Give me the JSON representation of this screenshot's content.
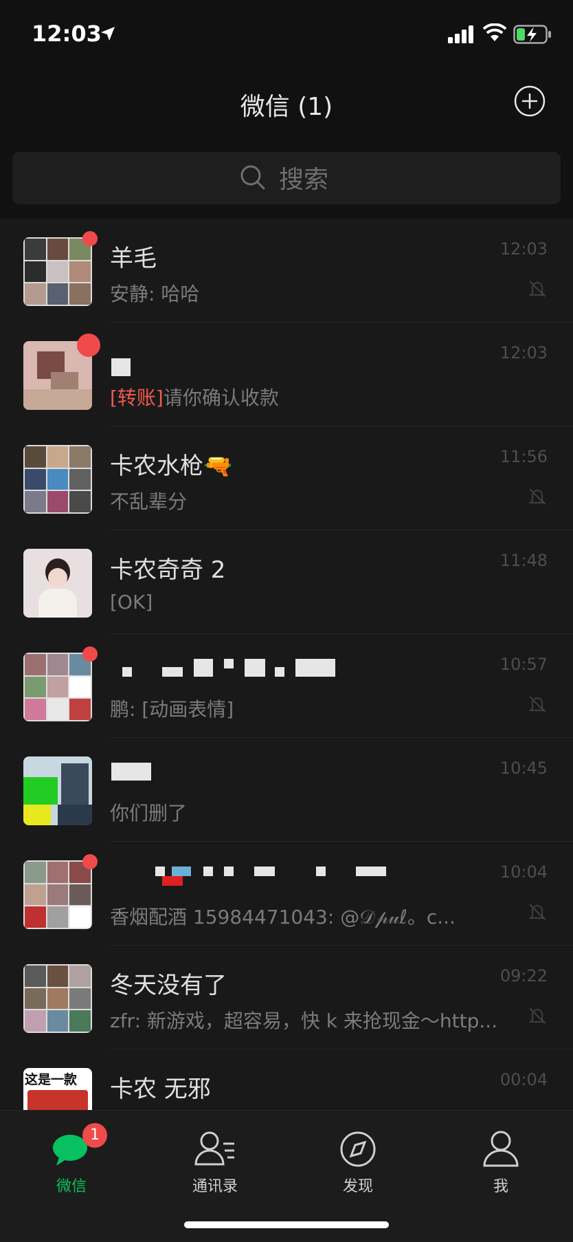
{
  "status_bar": {
    "time": "12:03",
    "icons": [
      "location-arrow-icon",
      "signal-icon",
      "wifi-icon",
      "battery-charging-icon"
    ]
  },
  "header": {
    "title": "微信 (1)",
    "add_icon": "plus-circle-icon"
  },
  "search": {
    "placeholder": "搜索",
    "icon": "search-icon"
  },
  "colors": {
    "accent": "#07c160",
    "badge": "#f14a4a",
    "transfer_tag": "#f05a4f",
    "background": "#191919"
  },
  "chats": [
    {
      "name": "羊毛",
      "preview": "安静: 哈哈",
      "time": "12:03",
      "muted": true,
      "unread_dot": true
    },
    {
      "name": "",
      "tag": "[转账]",
      "preview": "请你确认收款",
      "time": "12:03",
      "muted": false,
      "unread_dot": true
    },
    {
      "name": "卡农水枪🔫",
      "preview": "不乱辈分",
      "time": "11:56",
      "muted": true,
      "unread_dot": false
    },
    {
      "name": "卡农奇奇 2",
      "preview": "[OK]",
      "time": "11:48",
      "muted": false,
      "unread_dot": false
    },
    {
      "name": "",
      "preview": "鹏: [动画表情]",
      "time": "10:57",
      "muted": true,
      "unread_dot": true
    },
    {
      "name": "",
      "preview": "你们删了",
      "time": "10:45",
      "muted": false,
      "unread_dot": false
    },
    {
      "name": "",
      "preview": "香烟配酒 15984471043: @𝒟𝓅𝓊ℓ。c...",
      "time": "10:04",
      "muted": true,
      "unread_dot": true
    },
    {
      "name": "冬天没有了",
      "preview": "zfr: 新游戏，超容易，快 k 来抢现金～http...",
      "time": "09:22",
      "muted": true,
      "unread_dot": false
    },
    {
      "name": "卡农 无邪",
      "avatar_text": "这是一款",
      "preview": "",
      "time": "00:04",
      "muted": false,
      "unread_dot": false
    }
  ],
  "tabs": [
    {
      "label": "微信",
      "icon": "chat-bubble-icon",
      "active": true,
      "badge": "1"
    },
    {
      "label": "通讯录",
      "icon": "contacts-icon",
      "active": false
    },
    {
      "label": "发现",
      "icon": "compass-icon",
      "active": false
    },
    {
      "label": "我",
      "icon": "person-icon",
      "active": false
    }
  ]
}
